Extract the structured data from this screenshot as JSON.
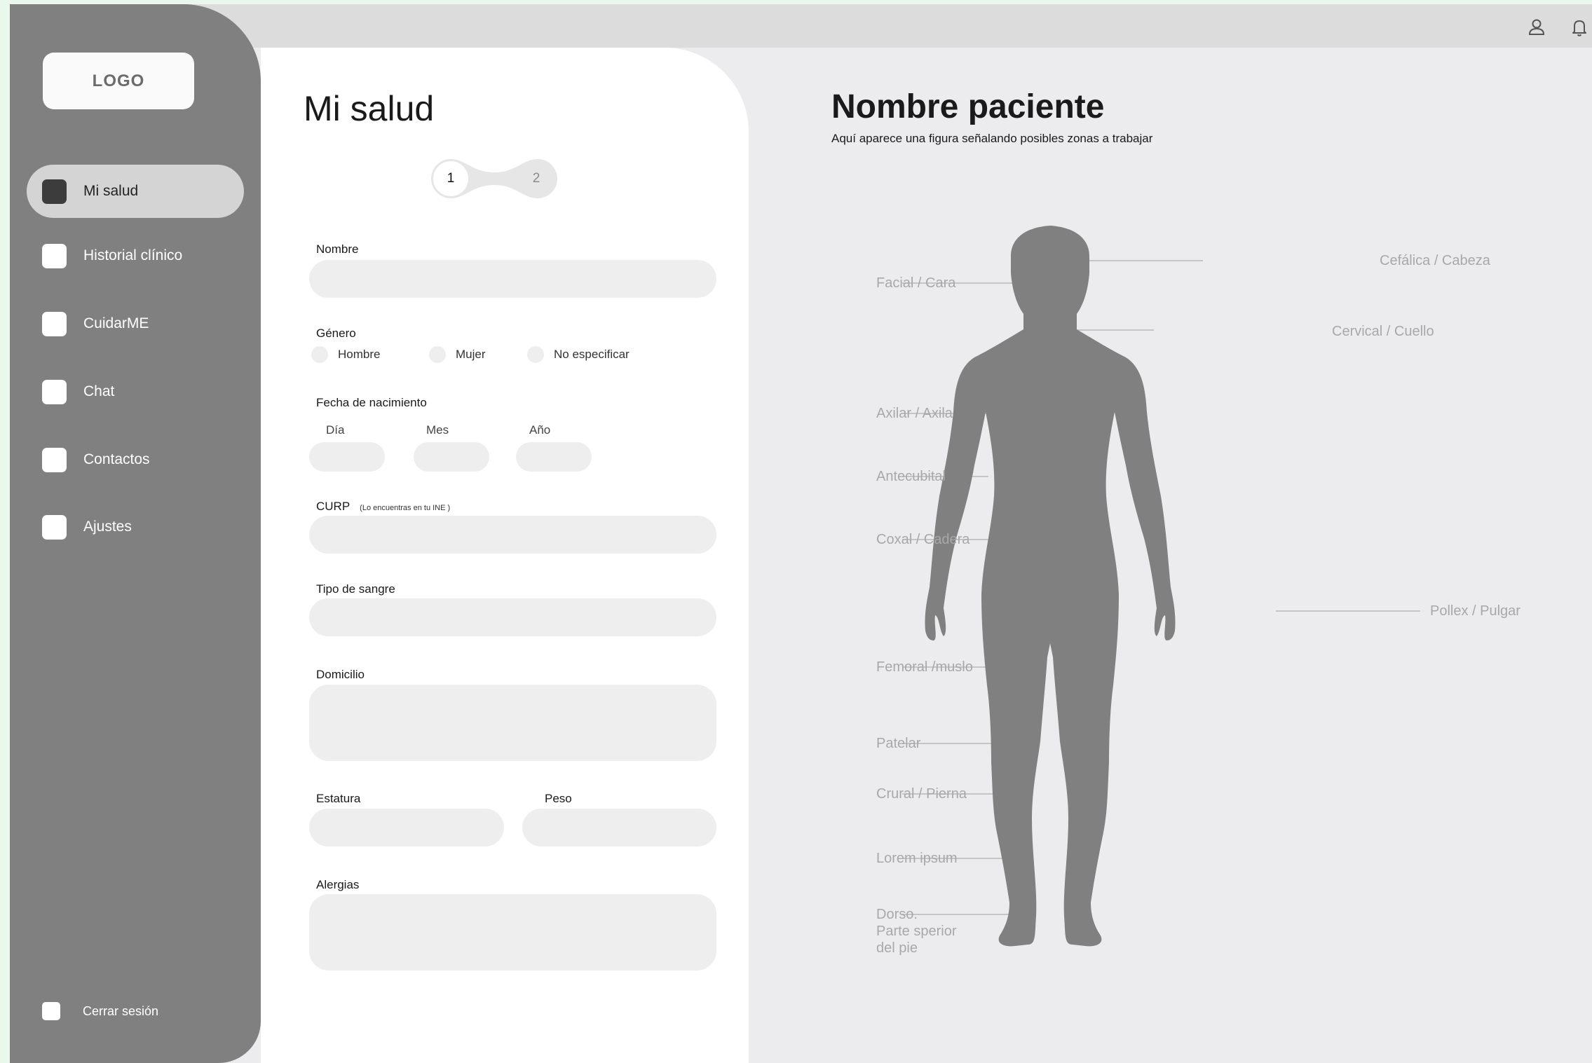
{
  "sidebar": {
    "logo": "LOGO",
    "items": [
      {
        "label": "Mi salud"
      },
      {
        "label": "Historial clínico"
      },
      {
        "label": "CuidarME"
      },
      {
        "label": "Chat"
      },
      {
        "label": "Contactos"
      },
      {
        "label": "Ajustes"
      }
    ],
    "logout": "Cerrar sesión"
  },
  "topbar": {
    "icons": [
      "user-icon",
      "bell-icon"
    ]
  },
  "form": {
    "title": "Mi salud",
    "steps": [
      "1",
      "2"
    ],
    "nombre_label": "Nombre",
    "genero_label": "Género",
    "genero_options": [
      "Hombre",
      "Mujer",
      "No especificar"
    ],
    "fecha_label": "Fecha de nacimiento",
    "dia_label": "Día",
    "mes_label": "Mes",
    "anio_label": "Año",
    "curp_label": "CURP",
    "curp_hint": "(Lo encuentras en tu INE )",
    "sangre_label": "Tipo de sangre",
    "domicilio_label": "Domicilio",
    "estatura_label": "Estatura",
    "peso_label": "Peso",
    "alergias_label": "Alergias"
  },
  "patient": {
    "title": "Nombre paciente",
    "subtitle": "Aquí aparece una figura señalando posibles zonas a trabajar",
    "zones_left": [
      "Facial / Cara",
      "Axilar / Axila",
      "Antecubital",
      "Coxal / Cadera",
      "Femoral /muslo",
      "Patelar",
      "Crural / Pierna",
      "Lorem ipsum",
      "Dorso.\nParte sperior\ndel pie"
    ],
    "zones_right": [
      "Cefálica / Cabeza",
      "Cervical / Cuello",
      "Pollex / Pulgar"
    ]
  },
  "colors": {
    "sidebar": "#808080",
    "active_nav": "#d4d4d4",
    "field_bg": "#eeeeee",
    "figure": "#808080",
    "zone_text": "#a8a8a8"
  }
}
